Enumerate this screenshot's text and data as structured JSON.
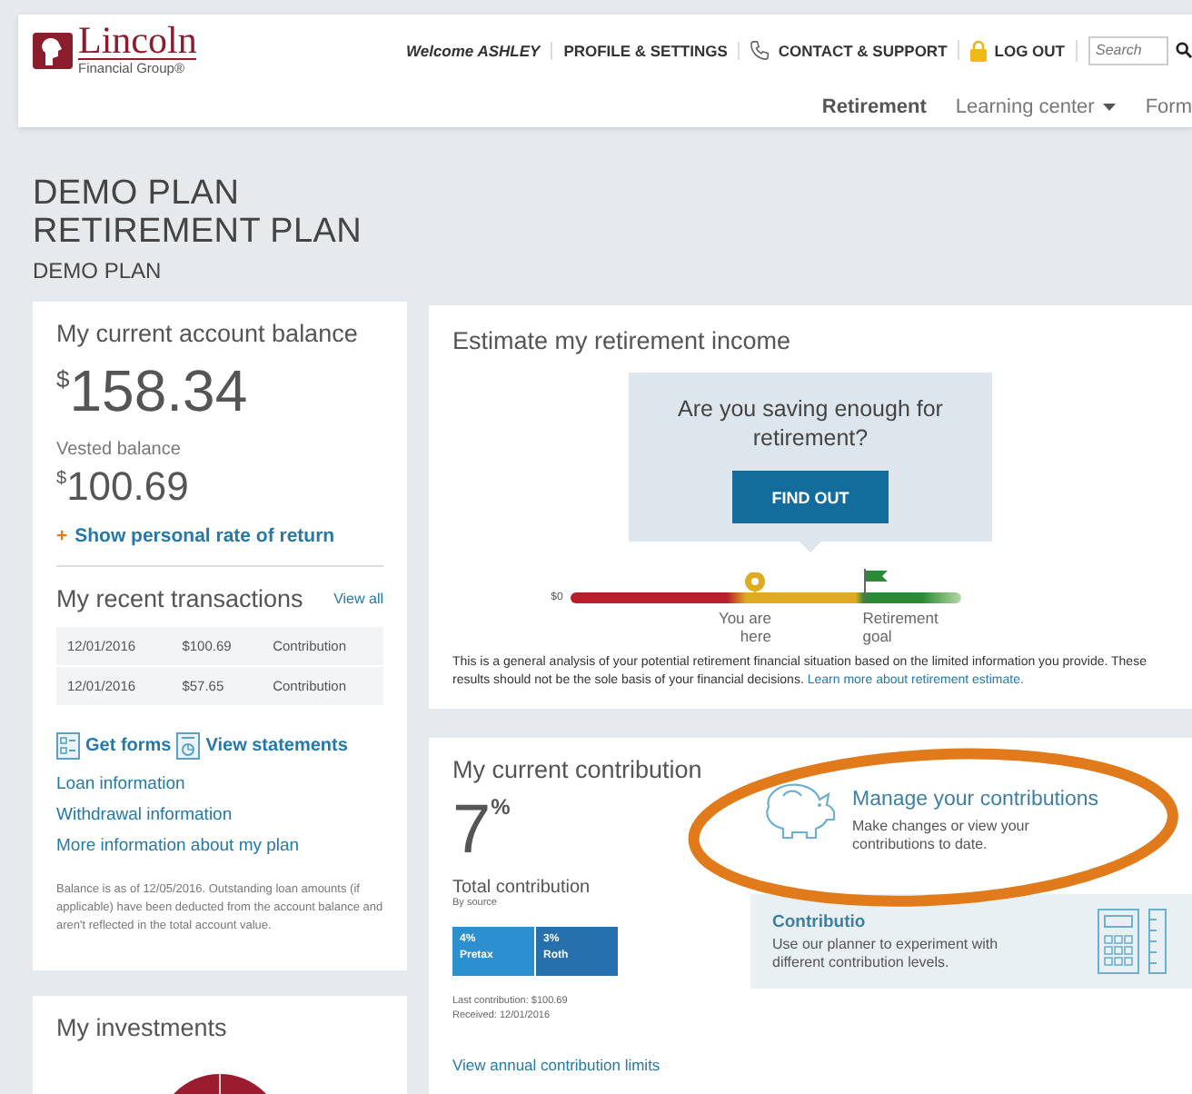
{
  "header": {
    "logo": {
      "name": "Lincoln",
      "subtitle": "Financial Group®"
    },
    "welcome": "Welcome ASHLEY",
    "links": [
      {
        "label": "PROFILE & SETTINGS",
        "kind": "text"
      },
      {
        "label": "CONTACT & SUPPORT",
        "kind": "phone"
      },
      {
        "label": "LOG OUT",
        "kind": "lock"
      }
    ],
    "search": {
      "placeholder": "Search"
    }
  },
  "nav": [
    {
      "label": "Retirement",
      "selected": true,
      "dropdown": false
    },
    {
      "label": "Learning center",
      "selected": false,
      "dropdown": true
    },
    {
      "label": "Form",
      "selected": false,
      "dropdown": false
    }
  ],
  "plan": {
    "title_lines": [
      "DEMO PLAN",
      "RETIREMENT PLAN"
    ],
    "subtitle": "DEMO PLAN"
  },
  "balance": {
    "title": "My current account balance",
    "currency": "$",
    "amount": "158.34",
    "vested_label": "Vested balance",
    "vested_currency": "$",
    "vested_amount": "100.69",
    "rate_link": "Show personal rate of return",
    "rate_prefix": "+"
  },
  "transactions": {
    "title": "My recent transactions",
    "view_all": "View all",
    "rows": [
      {
        "date": "12/01/2016",
        "amount": "$100.69",
        "type": "Contribution"
      },
      {
        "date": "12/01/2016",
        "amount": "$57.65",
        "type": "Contribution"
      }
    ]
  },
  "quick_links": [
    {
      "label": "Get forms",
      "kind": "forms"
    },
    {
      "label": "View statements",
      "kind": "statements"
    }
  ],
  "info_links": [
    "Loan information",
    "Withdrawal information",
    "More information about my plan"
  ],
  "balance_note": "Balance is as of 12/05/2016. Outstanding loan amounts (if applicable) have been deducted from the account balance and aren't reflected in the total account value.",
  "investments": {
    "title": "My investments"
  },
  "estimate": {
    "title": "Estimate my retirement income",
    "question": "Are you saving enough for retirement?",
    "button": "FIND OUT",
    "zero_label": "$0",
    "you_are_here": "You are here",
    "goal": "Retirement goal",
    "level": 0.47,
    "disclaimer": "This is a general analysis of your potential retirement financial situation based on the limited information you provide. These results should not be the sole basis of your financial decisions.",
    "learn_link": "Learn more about retirement estimate."
  },
  "contribution": {
    "title": "My current contribution",
    "percent": "7",
    "percent_sign": "%",
    "total_label": "Total contribution",
    "by_source": "By source",
    "sources": [
      {
        "percent": "4%",
        "name": "Pretax",
        "color": "#2b8fd0"
      },
      {
        "percent": "3%",
        "name": "Roth",
        "color": "#2670ad"
      }
    ],
    "last": "Last contribution: $100.69",
    "received": "Received: 12/01/2016",
    "limits_link": "View annual contribution limits",
    "manage_title": "Manage your contributions",
    "manage_text": "Make changes or view your contributions to date.",
    "planner_title": "Contributio",
    "planner_text": "Use our planner to experiment with different contribution levels."
  }
}
